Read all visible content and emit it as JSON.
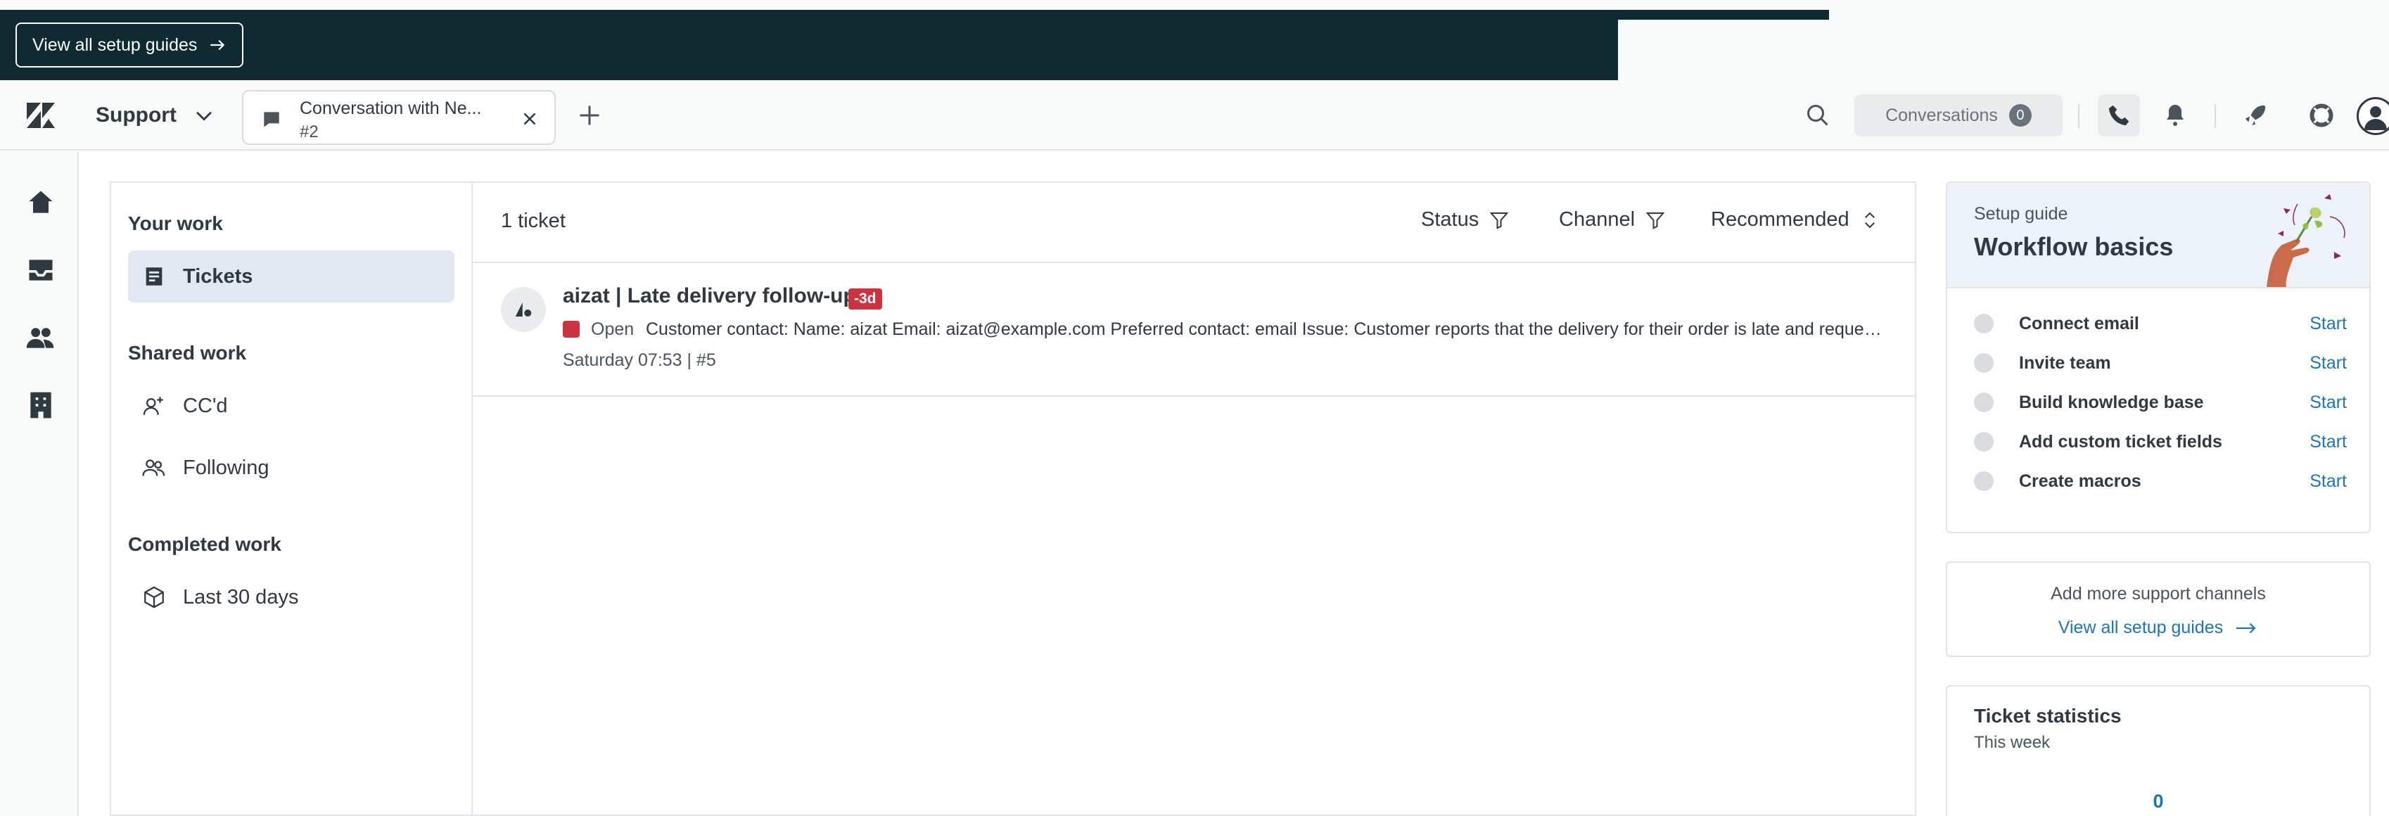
{
  "banner": {
    "guides_button_label": "View all setup guides"
  },
  "header": {
    "product_label": "Support",
    "tab": {
      "title": "Conversation with Ne...",
      "subtitle": "#2"
    },
    "conversations_label": "Conversations",
    "conversations_count": "0"
  },
  "views": {
    "your_work_heading": "Your work",
    "tickets_label": "Tickets",
    "shared_work_heading": "Shared work",
    "ccd_label": "CC'd",
    "following_label": "Following",
    "completed_work_heading": "Completed work",
    "last30_label": "Last 30 days"
  },
  "ticket_list": {
    "count_label": "1 ticket",
    "filters": {
      "status": "Status",
      "channel": "Channel",
      "sort": "Recommended"
    },
    "rows": [
      {
        "subject": "aizat | Late delivery follow-up",
        "badge": "-3d",
        "status": "Open",
        "preview": "Customer contact: Name: aizat Email: aizat@example.com Preferred contact: email Issue: Customer reports that the delivery for their order is late and requests an update.",
        "meta": "Saturday 07:53 | #5"
      }
    ]
  },
  "setup_guide": {
    "kicker": "Setup guide",
    "title": "Workflow basics",
    "items": [
      {
        "label": "Connect email",
        "action": "Start"
      },
      {
        "label": "Invite team",
        "action": "Start"
      },
      {
        "label": "Build knowledge base",
        "action": "Start"
      },
      {
        "label": "Add custom ticket fields",
        "action": "Start"
      },
      {
        "label": "Create macros",
        "action": "Start"
      }
    ]
  },
  "more_channels": {
    "text": "Add more support channels",
    "link": "View all setup guides"
  },
  "ticket_statistics": {
    "title": "Ticket statistics",
    "period": "This week",
    "value": "0"
  },
  "colors": {
    "banner_bg": "#0f2a31",
    "link": "#1f73b7",
    "sla_badge": "#cc3340",
    "active_view_bg": "#e1e8f2"
  }
}
